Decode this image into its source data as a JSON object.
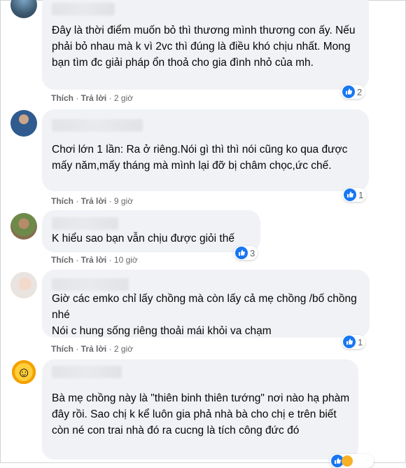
{
  "comments": [
    {
      "text": "Đây là thời điểm muốn bỏ thì thương mình thương con ấy. Nếu phải bỏ nhau mà k vì 2vc thì đúng là điều khó chịu nhất. Mong bạn tìm đc giải pháp ổn thoả cho gia đình nhỏ của mh.",
      "like_label": "Thích",
      "reply_label": "Trả lời",
      "time": "2 giờ",
      "reaction_count": "2",
      "reaction_icon": "like-icon"
    },
    {
      "text": "Chơi lớn 1 lần: Ra ở riêng.Nói gì thì thì nói cũng ko qua được mấy năm,mấy tháng mà mình lại đỡ bị châm chọc,ức chế.",
      "like_label": "Thích",
      "reply_label": "Trả lời",
      "time": "9 giờ",
      "reaction_count": "1",
      "reaction_icon": "like-icon"
    },
    {
      "text": "K hiểu sao bạn vẫn chịu được giỏi thế",
      "like_label": "Thích",
      "reply_label": "Trả lời",
      "time": "10 giờ",
      "reaction_count": "3",
      "reaction_icon": "like-icon"
    },
    {
      "text": "Giờ các emko chỉ lấy chồng mà còn lấy cả mẹ chồng /bố chồng nhé\nNói c hung sống riêng thoải mái khỏi va chạm",
      "like_label": "Thích",
      "reply_label": "Trả lời",
      "time": "2 giờ",
      "reaction_count": "1",
      "reaction_icon": "like-icon"
    },
    {
      "text": "Bà mẹ chồng này là \"thiên binh thiên tướng\" nơi nào hạ phàm đây rồi. Sao chị k kể luôn gia phả nhà bà cho chị e trên biết còn né con trai nhà đó ra cucng là tích công đức đó",
      "reaction_icon": "like-icon"
    }
  ],
  "separator": " · ",
  "colors": {
    "bubble": "#f0f2f5",
    "meta_text": "#65676b",
    "like_blue": "#1877f2"
  }
}
